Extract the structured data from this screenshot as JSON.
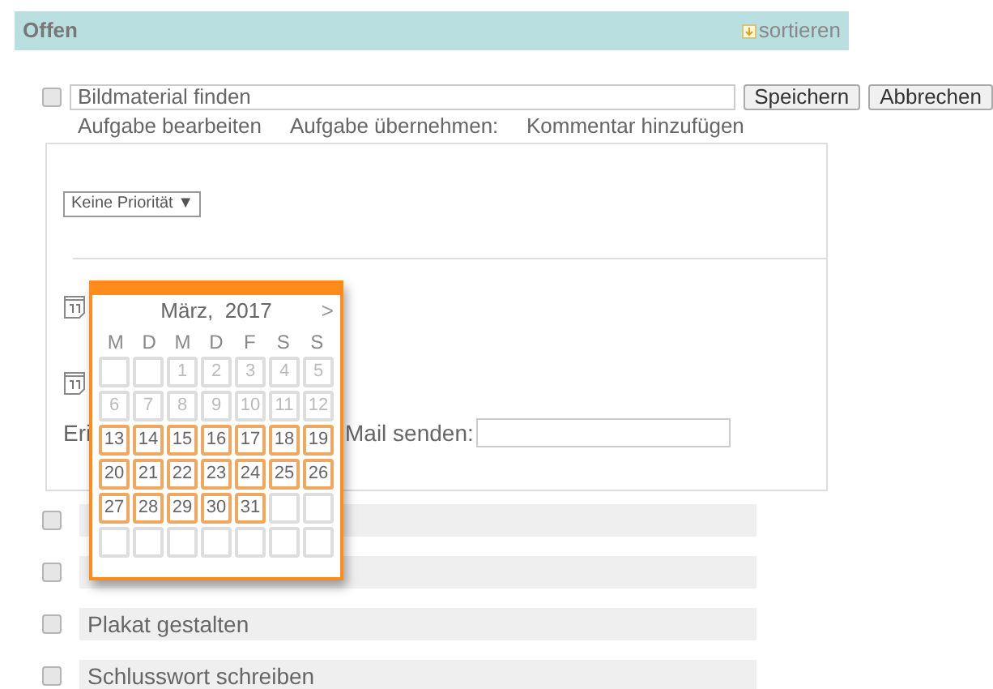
{
  "section": {
    "title": "Offen",
    "sort_label": "sortieren"
  },
  "editing_task": {
    "checked": false,
    "value": "Bildmaterial finden",
    "buttons": [
      "Speichern",
      "Abbrechen"
    ],
    "actions": [
      "Aufgabe bearbeiten",
      "Aufgabe übernehmen:",
      "Kommentar hinzufügen"
    ],
    "priority": "Keine Priorität ▼",
    "reminder_label": "Eri",
    "mail_label": "Mail senden:"
  },
  "datepicker": {
    "month": "März,  2017",
    "next": ">",
    "weekdays": [
      "M",
      "D",
      "M",
      "D",
      "F",
      "S",
      "S"
    ],
    "weeks": [
      [
        {
          "enabled": false
        },
        {
          "enabled": false
        },
        {
          "day": "1",
          "enabled": false
        },
        {
          "day": "2",
          "enabled": false
        },
        {
          "day": "3",
          "enabled": false
        },
        {
          "day": "4",
          "enabled": false
        },
        {
          "day": "5",
          "enabled": false
        }
      ],
      [
        {
          "day": "6",
          "enabled": false
        },
        {
          "day": "7",
          "enabled": false
        },
        {
          "day": "8",
          "enabled": false
        },
        {
          "day": "9",
          "enabled": false
        },
        {
          "day": "10",
          "enabled": false
        },
        {
          "day": "11",
          "enabled": false
        },
        {
          "day": "12",
          "enabled": false
        }
      ],
      [
        {
          "day": "13",
          "enabled": true
        },
        {
          "day": "14",
          "enabled": true
        },
        {
          "day": "15",
          "enabled": true
        },
        {
          "day": "16",
          "enabled": true
        },
        {
          "day": "17",
          "enabled": true
        },
        {
          "day": "18",
          "enabled": true
        },
        {
          "day": "19",
          "enabled": true
        }
      ],
      [
        {
          "day": "20",
          "enabled": true
        },
        {
          "day": "21",
          "enabled": true
        },
        {
          "day": "22",
          "enabled": true
        },
        {
          "day": "23",
          "enabled": true
        },
        {
          "day": "24",
          "enabled": true
        },
        {
          "day": "25",
          "enabled": true
        },
        {
          "day": "26",
          "enabled": true
        }
      ],
      [
        {
          "day": "27",
          "enabled": true
        },
        {
          "day": "28",
          "enabled": true
        },
        {
          "day": "29",
          "enabled": true
        },
        {
          "day": "30",
          "enabled": true
        },
        {
          "day": "31",
          "enabled": true
        },
        {
          "enabled": false
        },
        {
          "enabled": false
        }
      ],
      [
        {
          "enabled": false
        },
        {
          "enabled": false
        },
        {
          "enabled": false
        },
        {
          "enabled": false
        },
        {
          "enabled": false
        },
        {
          "enabled": false
        },
        {
          "enabled": false
        }
      ]
    ]
  },
  "tasks": [
    {
      "checked": false
    },
    {
      "checked": false
    },
    {
      "checked": false,
      "title": "Plakat gestalten"
    },
    {
      "checked": false,
      "title": "Schlusswort schreiben"
    }
  ]
}
